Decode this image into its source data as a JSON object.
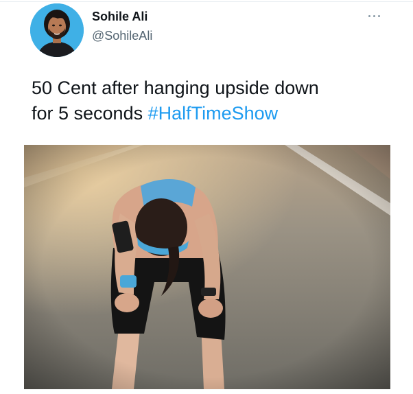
{
  "author": {
    "display_name": "Sohile Ali",
    "handle": "@SohileAli",
    "avatar_icon": "person-portrait"
  },
  "more_icon": "ellipsis-icon",
  "tweet": {
    "text_line1": "50 Cent after hanging upside down",
    "text_line2_prefix": "for 5 seconds ",
    "hashtag": "#HalfTimeShow"
  },
  "colors": {
    "hashtag": "#1d9bf0",
    "avatar_bg": "#3fb0e6",
    "text": "#0f1419",
    "secondary": "#536471"
  }
}
